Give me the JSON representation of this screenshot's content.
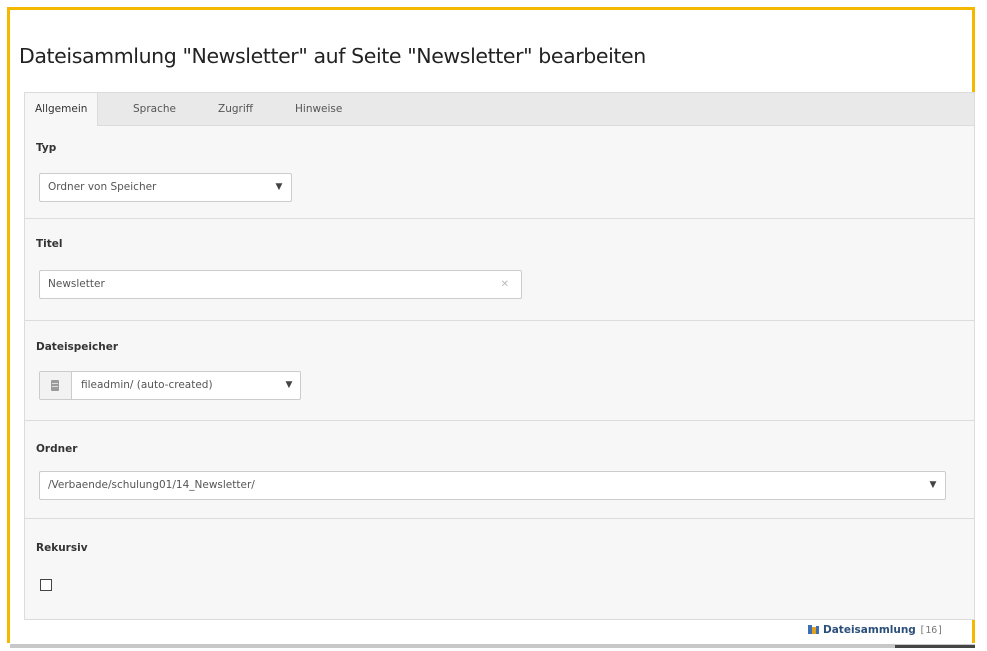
{
  "page": {
    "title": "Dateisammlung \"Newsletter\" auf Seite \"Newsletter\" bearbeiten"
  },
  "tabs": [
    {
      "label": "Allgemein",
      "active": true
    },
    {
      "label": "Sprache",
      "active": false
    },
    {
      "label": "Zugriff",
      "active": false
    },
    {
      "label": "Hinweise",
      "active": false
    }
  ],
  "form": {
    "typ": {
      "label": "Typ",
      "value": "Ordner von Speicher"
    },
    "titel": {
      "label": "Titel",
      "value": "Newsletter"
    },
    "dateispeicher": {
      "label": "Dateispeicher",
      "value": "fileadmin/ (auto-created)"
    },
    "ordner": {
      "label": "Ordner",
      "value": "/Verbaende/schulung01/14_Newsletter/"
    },
    "rekursiv": {
      "label": "Rekursiv",
      "checked": false
    }
  },
  "footer": {
    "record_type": "Dateisammlung",
    "record_id": "[16]"
  },
  "icons": {
    "dropdown": "chevron-down-icon",
    "clear": "clear-icon",
    "storage": "storage-icon",
    "record": "file-collection-icon"
  },
  "colors": {
    "frame_accent": "#f5b800",
    "record_link": "#2b4f7a"
  }
}
